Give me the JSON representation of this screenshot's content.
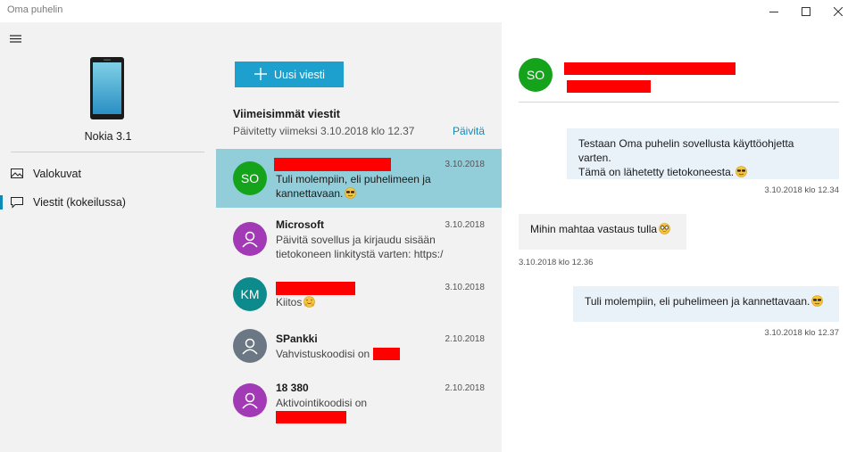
{
  "window": {
    "title": "Oma puhelin",
    "controls": [
      "minimize",
      "maximize",
      "close"
    ]
  },
  "sidebar": {
    "menu_icon": "hamburger-icon",
    "device_name": "Nokia 3.1",
    "items": [
      {
        "label": "Valokuvat",
        "icon": "photos-icon",
        "selected": false
      },
      {
        "label": "Viestit (kokeilussa)",
        "icon": "message-icon",
        "selected": true
      }
    ]
  },
  "messages": {
    "new_message_label": "Uusi viesti",
    "section_title": "Viimeisimmät viestit",
    "updated_text": "Päivitetty viimeksi 3.10.2018 klo 12.37",
    "refresh_label": "Päivitä",
    "conversations": [
      {
        "avatar_text": "SO",
        "avatar_color": "#16a31c",
        "name": "",
        "name_redacted": true,
        "date": "3.10.2018",
        "preview_lines": [
          "Tuli molempiin, eli puhelimeen ja",
          "kannettavaan."
        ],
        "emoji": "sunglasses",
        "selected": true
      },
      {
        "avatar_text": "",
        "avatar_icon": "person-icon",
        "avatar_color": "#a23ab6",
        "name": "Microsoft",
        "name_redacted": false,
        "date": "3.10.2018",
        "preview_lines": [
          "Päivitä sovellus ja kirjaudu sisään",
          "tietokoneen linkitystä varten: https:/"
        ],
        "selected": false
      },
      {
        "avatar_text": "KM",
        "avatar_color": "#0d8a8c",
        "name": "",
        "name_redacted": true,
        "date": "3.10.2018",
        "preview_lines": [
          "Kiitos"
        ],
        "emoji": "hugging",
        "selected": false
      },
      {
        "avatar_text": "",
        "avatar_icon": "person-icon",
        "avatar_color": "#6b7785",
        "name": "SPankki",
        "name_redacted": false,
        "date": "2.10.2018",
        "preview_lines": [
          "Vahvistuskoodisi on"
        ],
        "selected": false
      },
      {
        "avatar_text": "",
        "avatar_icon": "person-icon",
        "avatar_color": "#a23ab6",
        "name": "18 380",
        "name_redacted": false,
        "date": "2.10.2018",
        "preview_lines": [
          "Aktivointikoodisi on"
        ],
        "selected": false
      }
    ]
  },
  "conversation": {
    "avatar_text": "SO",
    "avatar_color": "#16a31c",
    "thread": [
      {
        "direction": "out",
        "lines": [
          "Testaan Oma puhelin sovellusta käyttöohjetta varten.",
          "Tämä on lähetetty tietokoneesta."
        ],
        "emoji": "sunglasses",
        "timestamp": "3.10.2018 klo 12.34"
      },
      {
        "direction": "in",
        "lines": [
          "Mihin mahtaa vastaus tulla"
        ],
        "emoji": "nerd",
        "timestamp": "3.10.2018 klo 12.36"
      },
      {
        "direction": "out",
        "lines": [
          "Tuli molempiin, eli puhelimeen ja kannettavaan."
        ],
        "emoji": "sunglasses",
        "timestamp": "3.10.2018 klo 12.37"
      }
    ]
  },
  "colors": {
    "accent": "#1ea0cf",
    "selected_row": "#92ceda",
    "link": "#1488b6",
    "redaction": "#ff0000"
  }
}
